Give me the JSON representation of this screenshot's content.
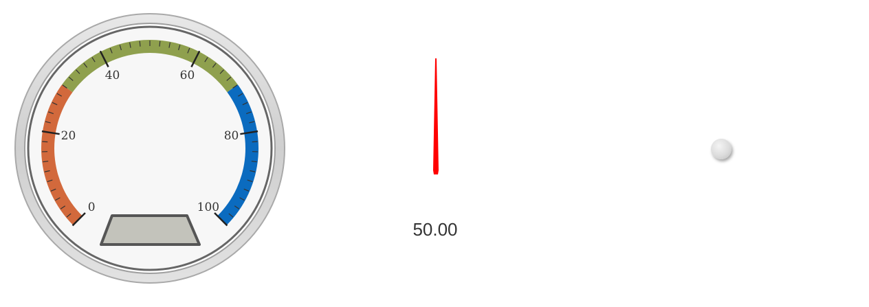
{
  "gauge": {
    "min": 0,
    "max": 100,
    "major_ticks": [
      "0",
      "20",
      "40",
      "60",
      "80",
      "100"
    ],
    "ranges": [
      {
        "from": 0,
        "to": 30,
        "color": "#d2693c"
      },
      {
        "from": 30,
        "to": 70,
        "color": "#8fa04e"
      },
      {
        "from": 70,
        "to": 100,
        "color": "#0b6bbf"
      }
    ],
    "face_color": "#f7f7f7",
    "frame_color": "#d4d4d4",
    "value_box_color": "#c3c3bb"
  },
  "needle": {
    "value": 50,
    "color": "#ff0000"
  },
  "readout": {
    "value_text": "50.00"
  },
  "pivot": {
    "icon": "needle-pivot-cap"
  }
}
